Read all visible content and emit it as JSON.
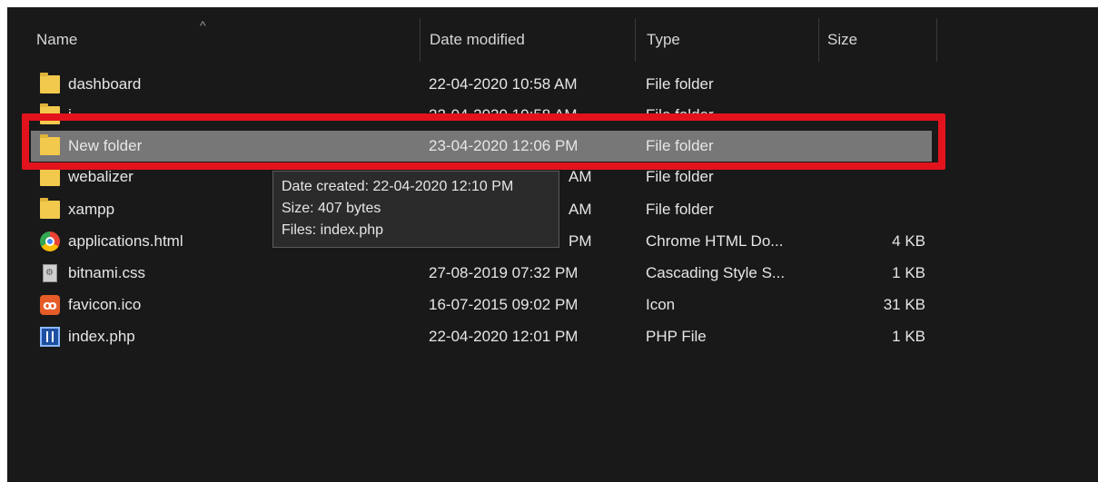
{
  "columns": {
    "name": "Name",
    "date_modified": "Date modified",
    "type": "Type",
    "size": "Size"
  },
  "files": [
    {
      "name": "dashboard",
      "date": "22-04-2020 10:58 AM",
      "type": "File folder",
      "size": "",
      "icon": "folder-icon"
    },
    {
      "name": "i",
      "date": "22-04-2020 10:58 AM",
      "type": "File folder",
      "size": "",
      "icon": "folder-icon"
    },
    {
      "name": "New folder",
      "date": "23-04-2020 12:06 PM",
      "type": "File folder",
      "size": "",
      "icon": "folder-icon",
      "selected": true
    },
    {
      "name": "webalizer",
      "date": "AM",
      "type": "File folder",
      "size": "",
      "icon": "folder-icon"
    },
    {
      "name": "xampp",
      "date": "AM",
      "type": "File folder",
      "size": "",
      "icon": "folder-icon"
    },
    {
      "name": "applications.html",
      "date": "PM",
      "type": "Chrome HTML Do...",
      "size": "4 KB",
      "icon": "chrome-icon"
    },
    {
      "name": "bitnami.css",
      "date": "27-08-2019 07:32 PM",
      "type": "Cascading Style S...",
      "size": "1 KB",
      "icon": "css-file-icon"
    },
    {
      "name": "favicon.ico",
      "date": "16-07-2015 09:02 PM",
      "type": "Icon",
      "size": "31 KB",
      "icon": "xampp-icon"
    },
    {
      "name": "index.php",
      "date": "22-04-2020 12:01 PM",
      "type": "PHP File",
      "size": "1 KB",
      "icon": "php-file-icon"
    }
  ],
  "tooltip": {
    "date_created": "Date created: 22-04-2020 12:10 PM",
    "size": "Size: 407 bytes",
    "files": "Files: index.php"
  },
  "colors": {
    "background": "#191919",
    "selected_row": "#777777",
    "highlight": "#e3131d",
    "folder": "#f2c94c"
  }
}
